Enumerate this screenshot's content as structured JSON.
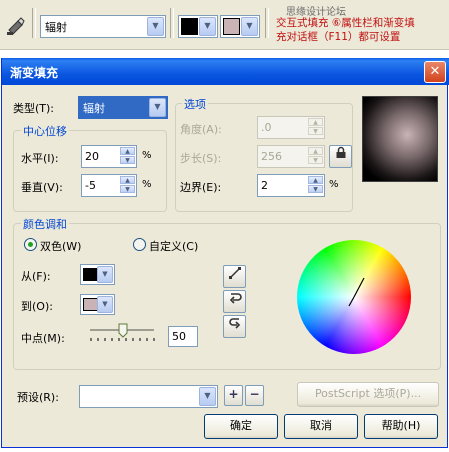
{
  "topbar": {
    "gradient_type_value": "辐射",
    "start_color": "#000000",
    "end_color": "#c9b3b6"
  },
  "watermark": {
    "line1": "思缘设计论坛",
    "line2": "交互式填充 ⑥属性栏和渐变填",
    "line3": "充对话框（F11）都可设置"
  },
  "dialog": {
    "title": "渐变填充",
    "type_label": "类型(T):",
    "type_value": "辐射",
    "center_offset_label": "中心位移",
    "horizontal_label": "水平(I):",
    "horizontal_value": "20",
    "vertical_label": "垂直(V):",
    "vertical_value": "-5",
    "percent": "%",
    "options_label": "选项",
    "angle_label": "角度(A):",
    "angle_value": ".0",
    "steps_label": "步长(S):",
    "steps_value": "256",
    "edge_label": "边界(E):",
    "edge_value": "2",
    "color_blend_label": "颜色调和",
    "two_color_label": "双色(W)",
    "custom_label": "自定义(C)",
    "from_label": "从(F):",
    "from_color": "#000000",
    "to_label": "到(O):",
    "to_color": "#c9b3b6",
    "midpoint_label": "中点(M):",
    "midpoint_value": "50",
    "preset_label": "预设(R):",
    "preset_value": "",
    "postscript_label": "PostScript 选项(P)...",
    "ok_label": "确定",
    "cancel_label": "取消",
    "help_label": "帮助(H)",
    "preview_center_color": "#c9b3b6",
    "preview_edge_color": "#000000"
  }
}
